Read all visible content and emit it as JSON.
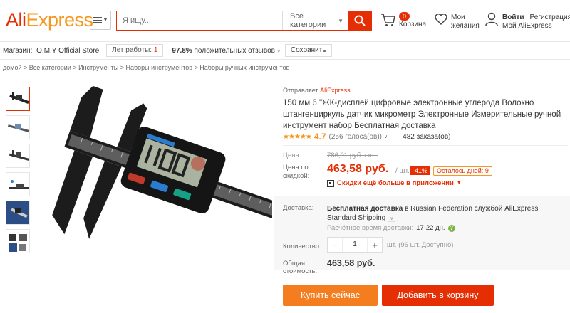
{
  "header": {
    "logo_ali": "Ali",
    "logo_express": "Express",
    "search_placeholder": "Я ищу...",
    "search_category": "Все категории",
    "cart_count": "0",
    "cart_label": "Корзина",
    "wish_label_1": "Мои",
    "wish_label_2": "желания",
    "login": "Войти",
    "register": "Регистрация",
    "my_account": "Мой AliExpress"
  },
  "store": {
    "label": "Магазин:",
    "name": "O.M.Y Official Store",
    "years_label": "Лет работы:",
    "years_value": "1",
    "positive_percent": "97.8%",
    "positive_label": "положительных отзывов",
    "save_label": "Сохранить"
  },
  "breadcrumb": "домой > Все категории > Инструменты > Наборы инструментов > Наборы ручных инструментов",
  "product": {
    "shipped_by_label": "Отправляет",
    "shipped_by": "AliExpress",
    "title": "150 мм 6 \"ЖК-дисплей цифровые электронные углерода Волокно штангенциркуль датчик микрометр Электронные Измерительные ручной инструмент набор Бесплатная доставка",
    "rating_stars": "★★★★★",
    "rating_score": "4.7",
    "votes": "(256 голоса(ов))",
    "orders": "482 заказа(ов)",
    "price_old_label": "Цена:",
    "price_old": "786,01 руб. / шт.",
    "price_label": "Цена со скидкой:",
    "price": "463,58 руб.",
    "price_unit": "/ шт.",
    "discount": "-41%",
    "days_left": "Осталось дней: 9",
    "app_promo": "Скидки ещё больше в приложении"
  },
  "shipping": {
    "label": "Доставка:",
    "text_bold": "Бесплатная доставка",
    "text_rest": " в Russian Federation службой AliExpress Standard Shipping",
    "time_label": "Расчётное время доставки:",
    "time_value": "17-22 дн."
  },
  "quantity": {
    "label": "Количество:",
    "value": "1",
    "available": "шт. (96 шт. Доступно)"
  },
  "total": {
    "label": "Общая стоимость:",
    "value": "463,58 руб."
  },
  "actions": {
    "buy_now": "Купить сейчас",
    "add_to_cart": "Добавить в корзину"
  },
  "colors": {
    "brand_red": "#e62e04",
    "brand_orange": "#f47d20"
  }
}
